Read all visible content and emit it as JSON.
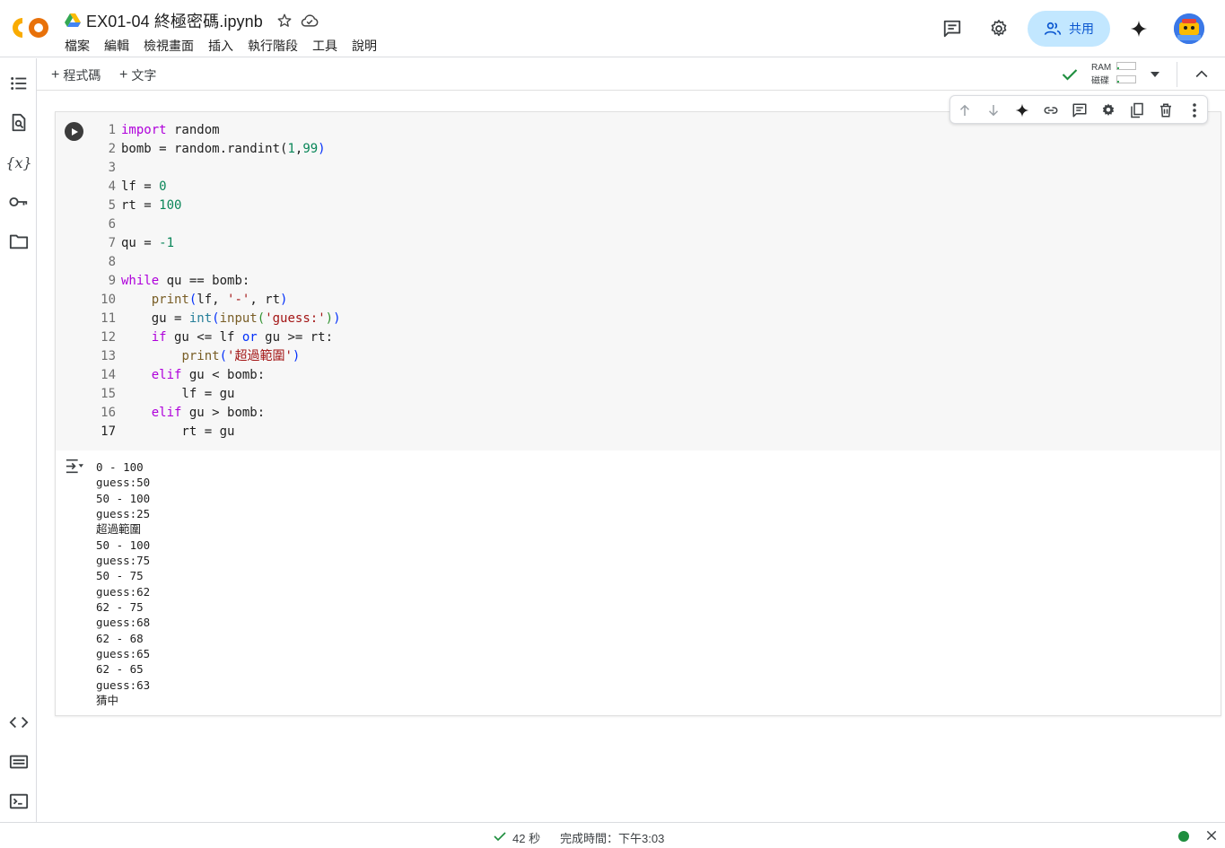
{
  "header": {
    "notebook_title": "EX01-04 終極密碼.ipynb",
    "menu": [
      "檔案",
      "編輯",
      "檢視畫面",
      "插入",
      "執行階段",
      "工具",
      "說明"
    ],
    "share_label": "共用"
  },
  "toolbar": {
    "add_code_label": "程式碼",
    "add_text_label": "文字",
    "ram_label": "RAM",
    "disk_label": "磁碟",
    "ram_usage": 0.1,
    "disk_usage": 0.1
  },
  "colors": {
    "accent": "#0b57d0",
    "share_bg": "#c2e7ff",
    "ok_green": "#1e8e3e",
    "keyword": "#af00db",
    "number": "#098658",
    "string": "#a31515",
    "function": "#795e26"
  },
  "cell": {
    "code_lines": [
      {
        "n": "1"
      },
      {
        "n": "2"
      },
      {
        "n": "3"
      },
      {
        "n": "4"
      },
      {
        "n": "5"
      },
      {
        "n": "6"
      },
      {
        "n": "7"
      },
      {
        "n": "8"
      },
      {
        "n": "9"
      },
      {
        "n": "10"
      },
      {
        "n": "11"
      },
      {
        "n": "12"
      },
      {
        "n": "13"
      },
      {
        "n": "14"
      },
      {
        "n": "15"
      },
      {
        "n": "16"
      },
      {
        "n": "17"
      }
    ],
    "tokens": {
      "l1": [
        "import",
        " random"
      ],
      "l2": [
        "bomb = random.randint(",
        "1",
        ",",
        "99",
        ")"
      ],
      "l4": [
        "lf = ",
        "0"
      ],
      "l5": [
        "rt = ",
        "100"
      ],
      "l7": [
        "qu = ",
        "-1"
      ],
      "l9": [
        "while",
        " qu == bomb:"
      ],
      "l10": [
        "    ",
        "print",
        "(",
        "lf, ",
        "'-'",
        ", rt",
        ")"
      ],
      "l11": [
        "    gu = ",
        "int",
        "(",
        "input",
        "(",
        "'guess:'",
        ")",
        ")"
      ],
      "l12": [
        "    ",
        "if",
        " gu <= lf ",
        "or",
        " gu >= rt:"
      ],
      "l13": [
        "        ",
        "print",
        "(",
        "'超過範圍'",
        ")"
      ],
      "l14": [
        "    ",
        "elif",
        " gu < bomb:"
      ],
      "l15": [
        "        lf = gu"
      ],
      "l16": [
        "    ",
        "elif",
        " gu > bomb:"
      ],
      "l17": [
        "        rt = gu"
      ]
    },
    "output_lines": [
      "0 - 100",
      "guess:50",
      "50 - 100",
      "guess:25",
      "超過範圍",
      "50 - 100",
      "guess:75",
      "50 - 75",
      "guess:62",
      "62 - 75",
      "guess:68",
      "62 - 68",
      "guess:65",
      "62 - 65",
      "guess:63",
      "猜中"
    ]
  },
  "statusbar": {
    "elapsed": "42 秒",
    "completed": "完成時間：下午3:03"
  },
  "icons": {
    "logo": "colab-logo",
    "drive": "google-drive-icon",
    "star": "star-icon",
    "cloud": "cloud-saved-icon",
    "comments": "comment-icon",
    "settings": "gear-icon",
    "gemini": "sparkle-icon",
    "toc": "table-of-contents-icon",
    "find": "find-icon",
    "variables": "variables-icon",
    "secrets": "key-icon",
    "files": "folder-icon",
    "code_snippets": "code-icon",
    "command_palette": "keyboard-icon",
    "terminal": "terminal-icon"
  }
}
